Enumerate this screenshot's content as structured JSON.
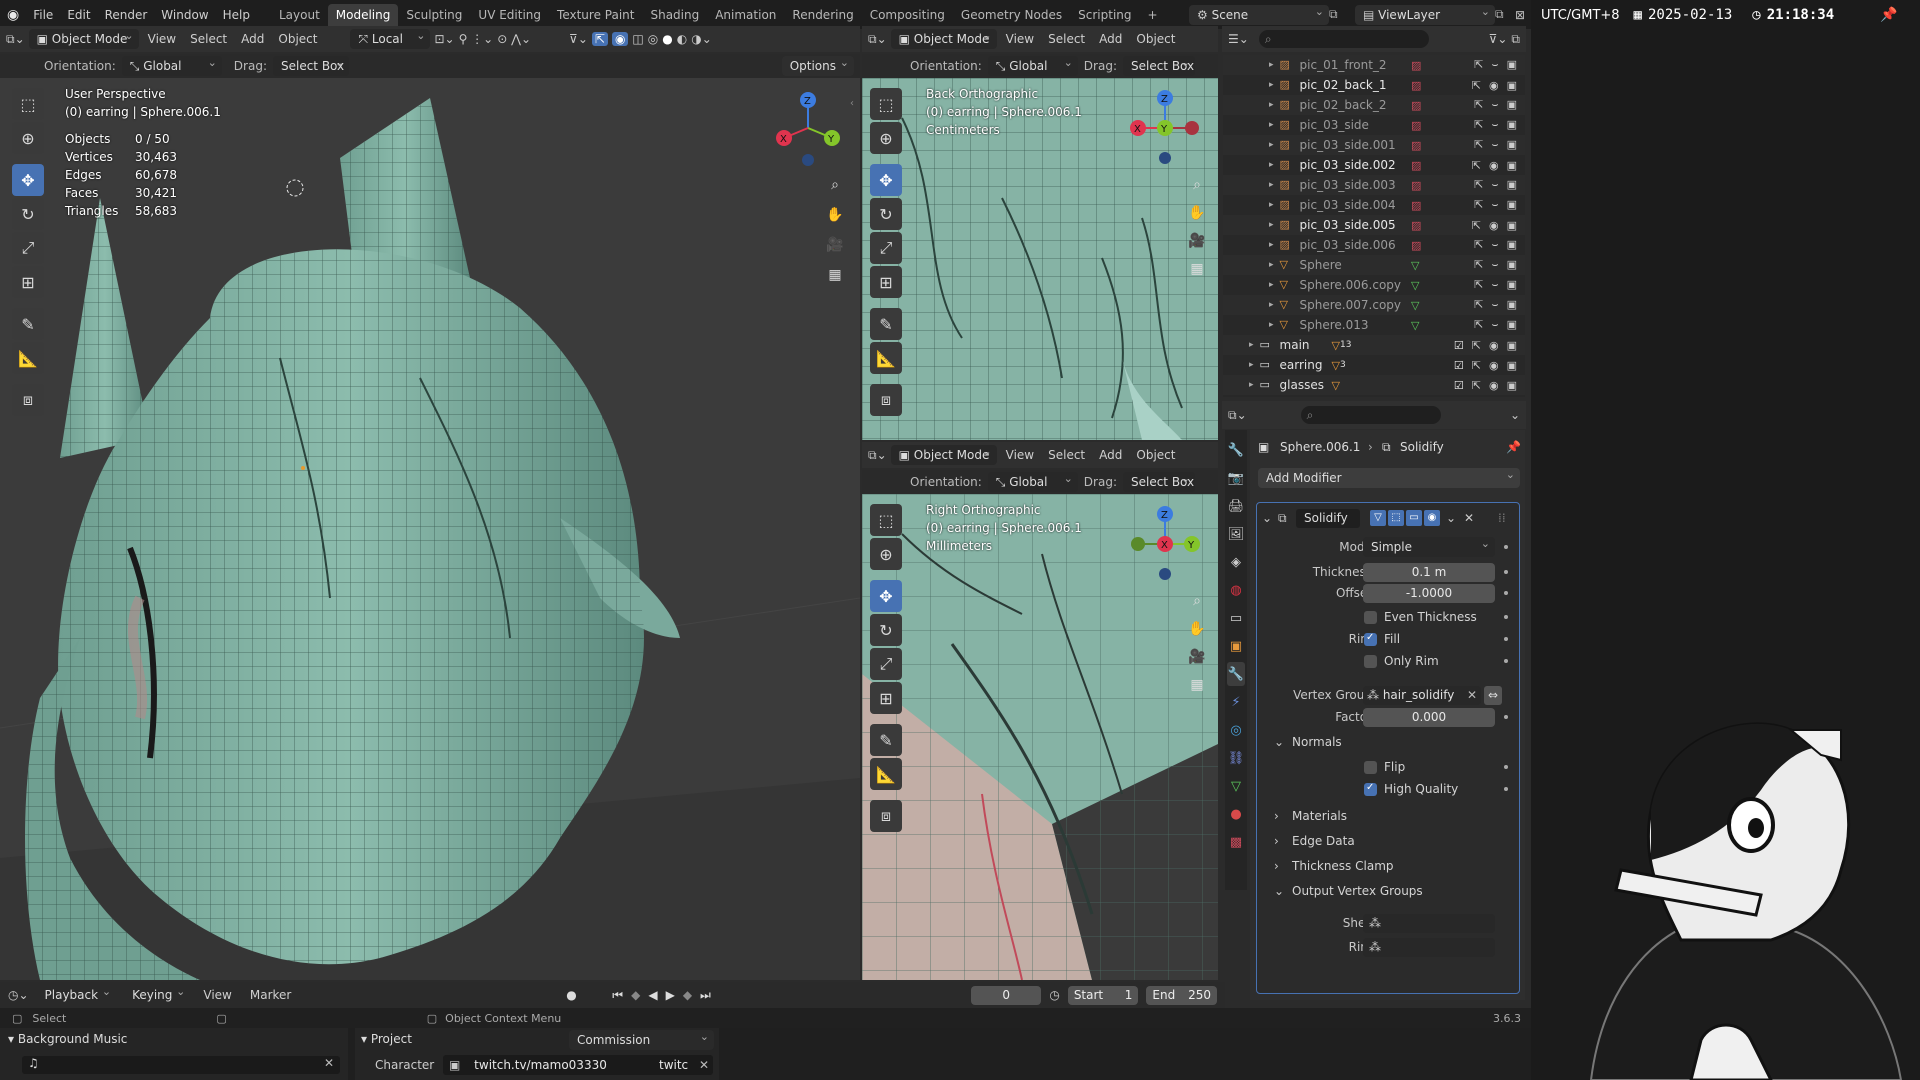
{
  "menu": {
    "items": [
      "File",
      "Edit",
      "Render",
      "Window",
      "Help"
    ],
    "workspaces": [
      "Layout",
      "Modeling",
      "Sculpting",
      "UV Editing",
      "Texture Paint",
      "Shading",
      "Animation",
      "Rendering",
      "Compositing",
      "Geometry Nodes",
      "Scripting"
    ],
    "active_workspace": "Modeling",
    "add_tab": "+",
    "scene": "Scene",
    "view_layer": "ViewLayer"
  },
  "main_viewport": {
    "mode": "Object Mode",
    "menus": [
      "View",
      "Select",
      "Add",
      "Object"
    ],
    "pivot": "Local",
    "orientation_label": "Orientation:",
    "orientation": "Global",
    "drag_label": "Drag:",
    "drag": "Select Box",
    "options": "Options",
    "view_name": "User Perspective",
    "context": "(0) earring | Sphere.006.1",
    "stats": [
      {
        "k": "Objects",
        "v": "0 / 50"
      },
      {
        "k": "Vertices",
        "v": "30,463"
      },
      {
        "k": "Edges",
        "v": "60,678"
      },
      {
        "k": "Faces",
        "v": "30,421"
      },
      {
        "k": "Triangles",
        "v": "58,683"
      }
    ]
  },
  "top_right_viewport": {
    "mode": "Object Mode",
    "menus": [
      "View",
      "Select",
      "Add",
      "Object"
    ],
    "orientation_label": "Orientation:",
    "orientation": "Global",
    "drag_label": "Drag:",
    "drag": "Select Box",
    "view_name": "Back Orthographic",
    "context": "(0) earring | Sphere.006.1",
    "units": "Centimeters"
  },
  "bottom_right_viewport": {
    "mode": "Object Mode",
    "menus": [
      "View",
      "Select",
      "Add",
      "Object"
    ],
    "orientation_label": "Orientation:",
    "orientation": "Global",
    "drag_label": "Drag:",
    "drag": "Select Box",
    "view_name": "Right Orthographic",
    "context": "(0) earring | Sphere.006.1",
    "units": "Millimeters"
  },
  "gizmo_axes": {
    "x": "X",
    "y": "Y",
    "z": "Z"
  },
  "outliner": {
    "rows": [
      {
        "name": "pic_01_front_2",
        "bright": false
      },
      {
        "name": "pic_02_back_1",
        "bright": true
      },
      {
        "name": "pic_02_back_2",
        "bright": false
      },
      {
        "name": "pic_03_side",
        "bright": false
      },
      {
        "name": "pic_03_side.001",
        "bright": false
      },
      {
        "name": "pic_03_side.002",
        "bright": true
      },
      {
        "name": "pic_03_side.003",
        "bright": false
      },
      {
        "name": "pic_03_side.004",
        "bright": false
      },
      {
        "name": "pic_03_side.005",
        "bright": true
      },
      {
        "name": "pic_03_side.006",
        "bright": false
      },
      {
        "name": "Sphere",
        "bright": false
      },
      {
        "name": "Sphere.006.copy",
        "bright": false
      },
      {
        "name": "Sphere.007.copy",
        "bright": false
      },
      {
        "name": "Sphere.013",
        "bright": false
      }
    ],
    "collections": [
      {
        "name": "main",
        "count": "13"
      },
      {
        "name": "earring",
        "count": "3"
      },
      {
        "name": "glasses",
        "count": ""
      }
    ]
  },
  "properties": {
    "object": "Sphere.006.1",
    "modifier_crumb": "Solidify",
    "add_modifier": "Add Modifier",
    "modifier_name": "Solidify",
    "mode_label": "Mode",
    "mode": "Simple",
    "thickness_label": "Thickness",
    "thickness": "0.1 m",
    "offset_label": "Offset",
    "offset": "-1.0000",
    "even_thickness": "Even Thickness",
    "rim_label": "Rim",
    "fill": "Fill",
    "only_rim": "Only Rim",
    "vertex_group_label": "Vertex Group",
    "vertex_group": "hair_solidify",
    "factor_label": "Factor",
    "factor": "0.000",
    "normals": "Normals",
    "flip": "Flip",
    "high_quality": "High Quality",
    "materials": "Materials",
    "edge_data": "Edge Data",
    "thickness_clamp": "Thickness Clamp",
    "output_vertex_groups": "Output Vertex Groups",
    "shell_label": "Shell",
    "rim2_label": "Rim"
  },
  "timeline": {
    "menus": [
      "Playback",
      "Keying",
      "View",
      "Marker"
    ],
    "frame": "0",
    "start_label": "Start",
    "start": "1",
    "end_label": "End",
    "end": "250"
  },
  "status": {
    "select": "Select",
    "context_menu": "Object Context Menu",
    "version": "3.6.3"
  },
  "bottom": {
    "bg_music": "Background Music",
    "project_label": "Project",
    "project_value": "Commission",
    "character_label": "Character",
    "link": "twitch.tv/mamo03330",
    "link_suffix": "twitc"
  },
  "hud": {
    "timezone": "UTC/GMT+8",
    "date": "2025-02-13",
    "time": "21:18:34"
  },
  "colors": {
    "accent": "#4772b3",
    "mesh": "#86b3a5",
    "wire": "#2e4a42",
    "axis_x": "#e0344e",
    "axis_y": "#84c52a",
    "axis_z": "#3c7ce0"
  }
}
